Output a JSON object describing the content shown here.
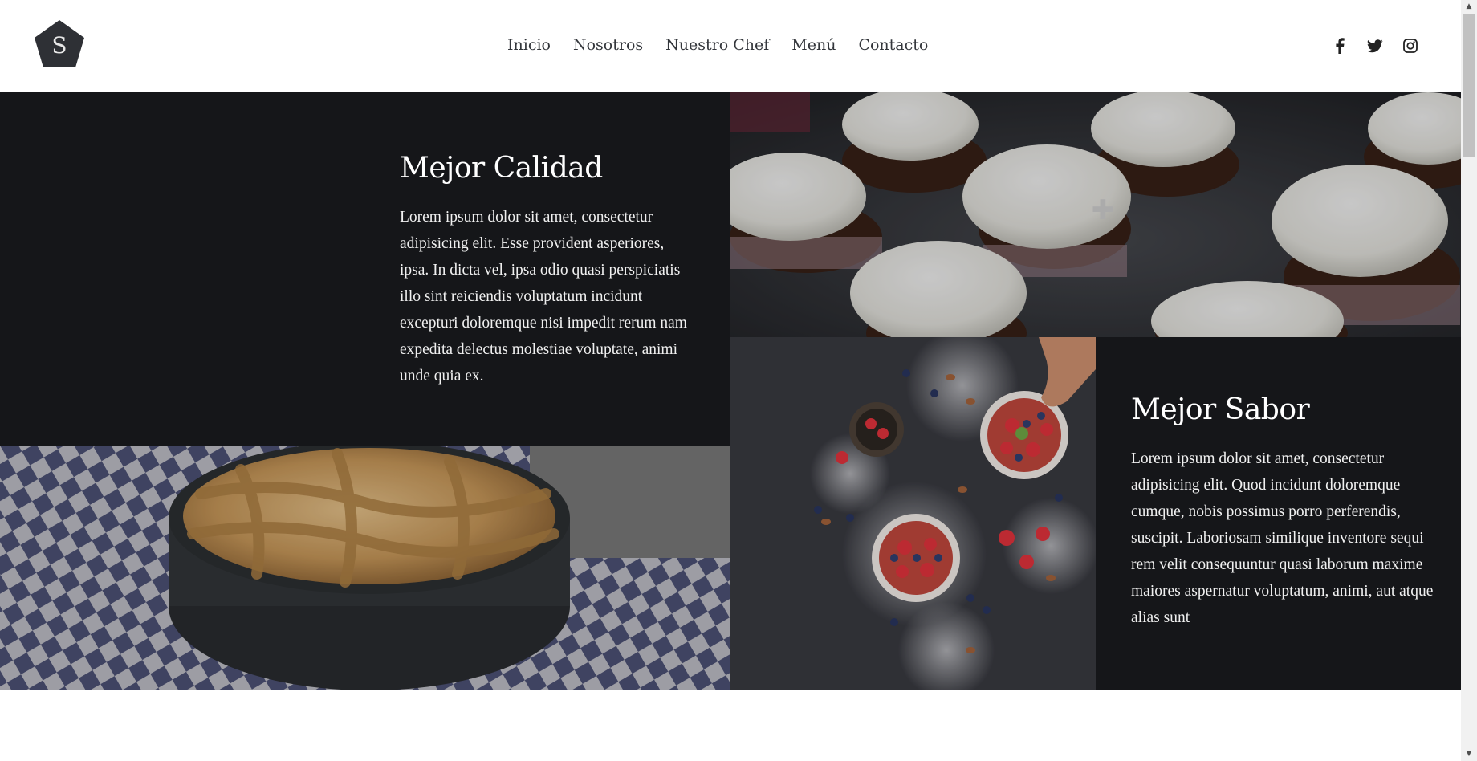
{
  "logo": {
    "letter": "S",
    "icon": "pentagon-logo-icon"
  },
  "nav": [
    {
      "label": "Inicio"
    },
    {
      "label": "Nosotros"
    },
    {
      "label": "Nuestro Chef"
    },
    {
      "label": "Menú"
    },
    {
      "label": "Contacto"
    }
  ],
  "social": [
    {
      "icon": "facebook-icon"
    },
    {
      "icon": "twitter-icon"
    },
    {
      "icon": "instagram-icon"
    }
  ],
  "sections": {
    "quality": {
      "title": "Mejor Calidad",
      "text": "Lorem ipsum dolor sit amet, consectetur adipisicing elit. Esse provident asperiores, ipsa. In dicta vel, ipsa odio quasi perspiciatis illo sint reiciendis voluptatum incidunt excepturi doloremque nisi impedit rerum nam expedita delectus molestiae voluptate, animi unde quia ex."
    },
    "flavor": {
      "title": "Mejor Sabor",
      "text": "Lorem ipsum dolor sit amet, consectetur adipisicing elit. Quod incidunt doloremque cumque, nobis possimus porro perferendis, suscipit. Laboriosam similique inventore sequi rem velit consequuntur quasi laborum maxime maiores aspernatur voluptatum, animi, aut atque alias sunt"
    }
  },
  "colors": {
    "dark": "#151619",
    "accent": "#2e3035"
  }
}
